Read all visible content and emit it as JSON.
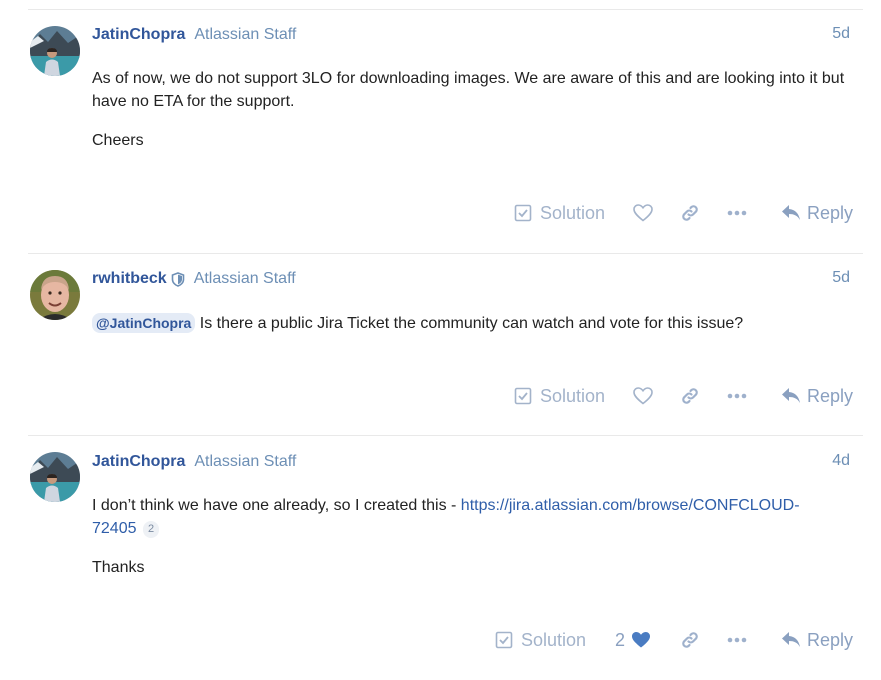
{
  "posts": [
    {
      "username": "JatinChopra",
      "title": "Atlassian Staff",
      "date": "5d",
      "body": {
        "p1": "As of now, we do not support 3LO for downloading images. We are aware of this and are looking into it but have no ETA for the support.",
        "p2": "Cheers"
      },
      "actions": {
        "solution": "Solution",
        "reply": "Reply"
      }
    },
    {
      "username": "rwhitbeck",
      "title": "Atlassian Staff",
      "date": "5d",
      "body": {
        "mention": "@JatinChopra",
        "text": " Is there a public Jira Ticket the community can watch and vote for this issue?"
      },
      "actions": {
        "solution": "Solution",
        "reply": "Reply"
      }
    },
    {
      "username": "JatinChopra",
      "title": "Atlassian Staff",
      "date": "4d",
      "body": {
        "text": "I don’t think we have one already, so I created this - ",
        "link": "https://jira.atlassian.com/browse/CONFCLOUD-72405",
        "link_clicks": "2",
        "p2": "Thanks"
      },
      "actions": {
        "solution": "Solution",
        "like_count": "2",
        "reply": "Reply"
      }
    }
  ],
  "colors": {
    "username": "#31569a",
    "staff_title": "#6d8fb5",
    "action_icon": "#9fb1cc",
    "liked_heart": "#4a7cc2",
    "link": "#2f5ea9"
  }
}
